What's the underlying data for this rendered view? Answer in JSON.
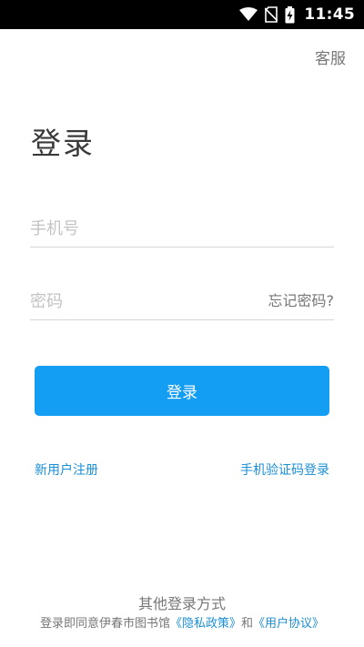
{
  "status_bar": {
    "time": "11:45",
    "icons": [
      "wifi-icon",
      "no-sim-icon",
      "battery-charging-icon"
    ]
  },
  "header": {
    "support_label": "客服"
  },
  "page": {
    "title": "登录"
  },
  "form": {
    "phone_placeholder": "手机号",
    "phone_value": "",
    "password_placeholder": "密码",
    "password_value": "",
    "forgot_label": "忘记密码?",
    "login_label": "登录"
  },
  "links": {
    "register_label": "新用户注册",
    "sms_login_label": "手机验证码登录"
  },
  "footer": {
    "other_login_label": "其他登录方式",
    "agreement_prefix": "登录即同意伊春市图书馆",
    "privacy_label": "《隐私政策》",
    "and_label": "和",
    "user_agreement_label": "《用户协议》"
  },
  "colors": {
    "accent": "#139df3",
    "link": "#1b8fd6",
    "status_bar": "#000000"
  }
}
